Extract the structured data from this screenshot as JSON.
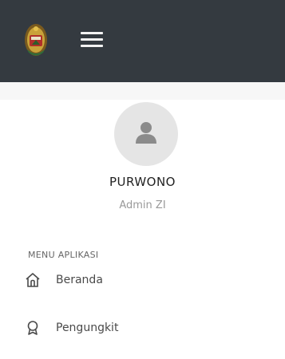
{
  "header": {
    "logo": "crest-logo-icon",
    "menu_toggle": "hamburger-menu-icon"
  },
  "profile": {
    "avatar_icon": "user-icon",
    "name": "PURWONO",
    "role": "Admin ZI"
  },
  "menu": {
    "heading": "MENU APLIKASI",
    "items": [
      {
        "label": "Beranda",
        "icon": "home-icon"
      },
      {
        "label": "Pengungkit",
        "icon": "award-icon"
      }
    ]
  },
  "colors": {
    "topbar": "#343a40",
    "avatar_bg": "#e5e5e5",
    "text_muted": "#999999"
  }
}
